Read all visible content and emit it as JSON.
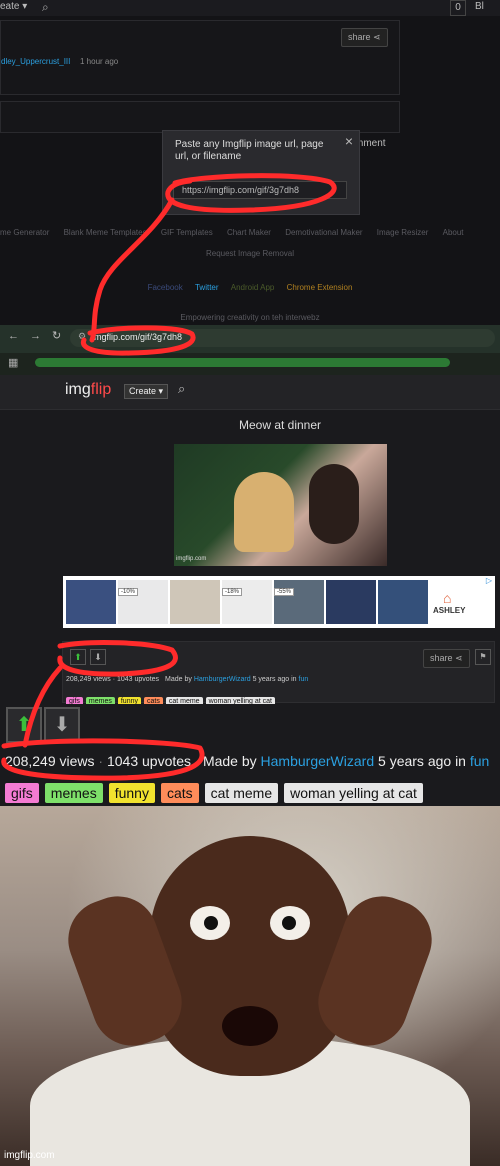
{
  "topbar": {
    "create_fragment": "eate ▾",
    "counter": "0",
    "right_fragment": "Bl"
  },
  "comment": {
    "author": "dley_Uppercrust_III",
    "time": "1 hour ago",
    "share_label": "share",
    "comment_fragment": "mment"
  },
  "popup": {
    "prompt": "Paste any Imgflip image url, page url, or filename",
    "value": "https://imgflip.com/gif/3g7dh8",
    "close": "×"
  },
  "footer": {
    "links": [
      "me Generator",
      "Blank Meme Templates",
      "GIF Templates",
      "Chart Maker",
      "Demotivational Maker",
      "Image Resizer",
      "About"
    ],
    "request": "Request Image Removal",
    "social": [
      "Facebook",
      "Twitter",
      "Android App",
      "Chrome Extension"
    ],
    "tagline": "Empowering creativity on teh interwebz"
  },
  "browser": {
    "url": "imgflip.com/gif/3g7dh8"
  },
  "imgflip": {
    "logo_a": "img",
    "logo_b": "flip",
    "create": "Create ▾",
    "title": "Meow at dinner",
    "watermark": "imgflip.com",
    "ad": {
      "badges": [
        "-10%",
        "-18%",
        "-55%"
      ],
      "brand": "ASHLEY"
    },
    "share": "share",
    "views": "208,249 views",
    "upvotes": "1043 upvotes",
    "made_by": "Made by",
    "author": "HamburgerWizard",
    "ago": "5 years ago in",
    "stream": "fun",
    "tags": [
      {
        "label": "gifs",
        "color": "#f47bd3"
      },
      {
        "label": "memes",
        "color": "#7ee06a"
      },
      {
        "label": "funny",
        "color": "#f1e22e"
      },
      {
        "label": "cats",
        "color": "#ff8c5a"
      },
      {
        "label": "cat meme",
        "color": "#e6e6e6"
      },
      {
        "label": "woman yelling at cat",
        "color": "#e6e6e6"
      }
    ]
  },
  "bottom": {
    "watermark": "imgflip.com"
  },
  "colors": {
    "annotation": "#ff2b2b",
    "upvote": "#3bbf3b",
    "link": "#2ba0e0"
  }
}
